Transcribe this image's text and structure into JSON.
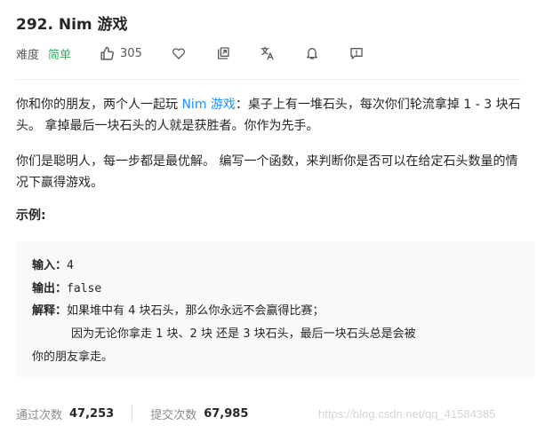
{
  "problem": {
    "title": "292. Nim 游戏",
    "difficulty_label": "难度",
    "difficulty_value": "简单",
    "likes": "305",
    "description": {
      "p1_before_link": "你和你的朋友，两个人一起玩 ",
      "p1_link": "Nim 游戏",
      "p1_after_link": "：桌子上有一堆石头，每次你们轮流拿掉 1 - 3 块石头。 拿掉最后一块石头的人就是获胜者。你作为先手。",
      "p2": "你们是聪明人，每一步都是最优解。 编写一个函数，来判断你是否可以在给定石头数量的情况下赢得游戏。"
    },
    "example": {
      "title": "示例:",
      "input_label": "输入：",
      "input_value": "4",
      "output_label": "输出：",
      "output_value": "false",
      "explanation_label": "解释：",
      "explanation_line1": "如果堆中有 4 块石头，那么你永远不会赢得比赛；",
      "explanation_line2": "因为无论你拿走 1 块、2 块 还是 3 块石头，最后一块石头总是会被",
      "explanation_line3": "你的朋友拿走。"
    },
    "stats": {
      "passed_label": "通过次数",
      "passed_value": "47,253",
      "submitted_label": "提交次数",
      "submitted_value": "67,985"
    }
  },
  "icons": {
    "like": "thumbs-up-icon",
    "favorite": "heart-icon",
    "share": "share-icon",
    "translate": "translate-icon",
    "notify": "bell-icon",
    "feedback": "feedback-icon"
  },
  "colors": {
    "difficulty_easy": "#2db55d",
    "link": "#1a90ff",
    "code_bg": "#f7f9fa"
  },
  "watermark": "https://blog.csdn.net/qq_41584385"
}
